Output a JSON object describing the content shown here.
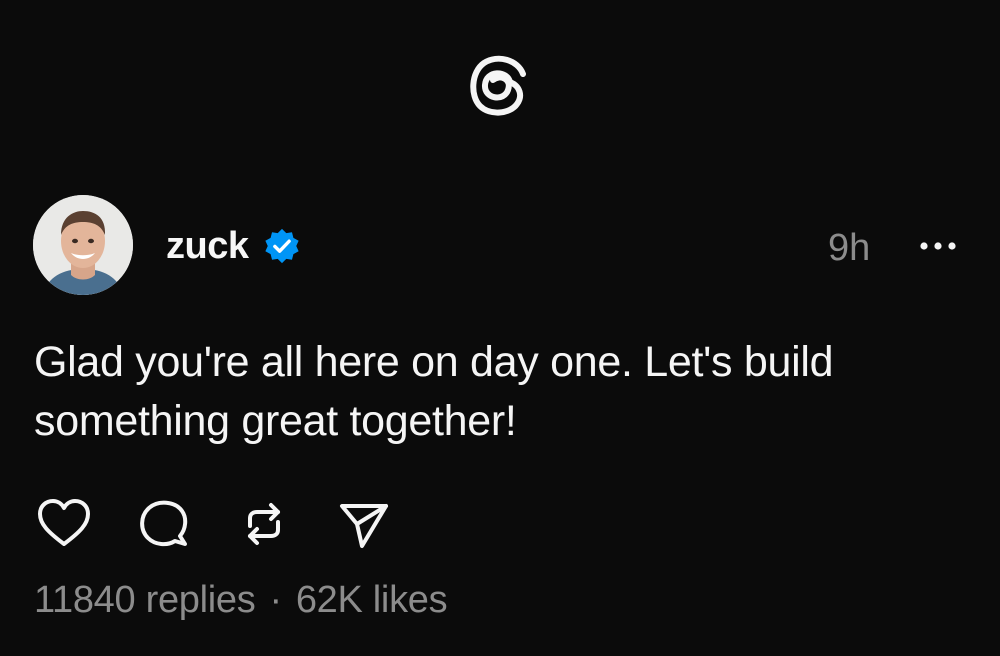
{
  "app": {
    "logo_icon": "threads-logo-icon"
  },
  "post": {
    "author": {
      "username": "zuck",
      "verified": true,
      "verified_color": "#0095f6",
      "avatar_icon": "user-avatar"
    },
    "timestamp": "9h",
    "more_icon": "more-horizontal-icon",
    "text": "Glad you're all here on day one. Let's build something great together!",
    "actions": [
      {
        "name": "like",
        "icon": "heart-icon"
      },
      {
        "name": "reply",
        "icon": "comment-icon"
      },
      {
        "name": "repost",
        "icon": "repost-icon"
      },
      {
        "name": "share",
        "icon": "send-icon"
      }
    ],
    "stats": {
      "replies": "11840 replies",
      "separator": "·",
      "likes": "62K likes"
    }
  },
  "colors": {
    "background": "#0b0b0b",
    "text": "#f5f5f5",
    "muted": "#8c8c8c",
    "verified": "#0095f6"
  }
}
